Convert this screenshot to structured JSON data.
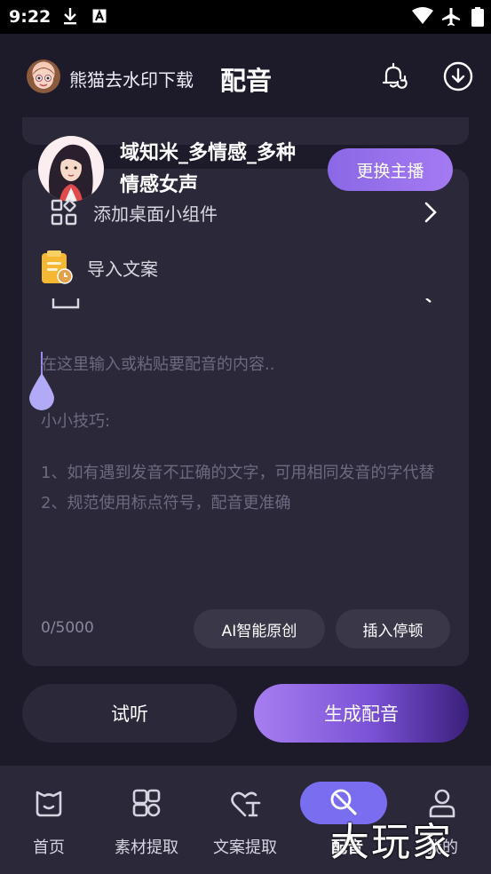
{
  "statusbar": {
    "time": "9:22"
  },
  "appbar": {
    "username": "熊猫去水印下载",
    "title": "配音"
  },
  "anchor": {
    "name": "域知米_多情感_多种情感女声",
    "change_label": "更换主播"
  },
  "menu": {
    "widget_label": "添加桌面小组件",
    "import_label": "导入文案"
  },
  "editor": {
    "placeholder": "在这里输入或粘贴要配音的内容..",
    "tips_title": "小小技巧:",
    "tip1": "1、如有遇到发音不正确的文字，可用相同发音的字代替",
    "tip2": "2、规范使用标点符号，配音更准确",
    "counter": "0/5000",
    "ai_label": "AI智能原创",
    "pause_label": "插入停顿"
  },
  "actions": {
    "listen_label": "试听",
    "generate_label": "生成配音"
  },
  "tabs": [
    {
      "label": "首页",
      "icon": "home-icon"
    },
    {
      "label": "素材提取",
      "icon": "material-icon"
    },
    {
      "label": "文案提取",
      "icon": "text-extract-icon"
    },
    {
      "label": "配音",
      "icon": "dubbing-icon",
      "active": true
    },
    {
      "label": "我的",
      "icon": "profile-icon"
    }
  ],
  "watermark": "大玩家",
  "colors": {
    "background": "#1d1b29",
    "card": "#2a2839",
    "accent": "#8b68e6",
    "tab_active": "#7a6ef0"
  }
}
